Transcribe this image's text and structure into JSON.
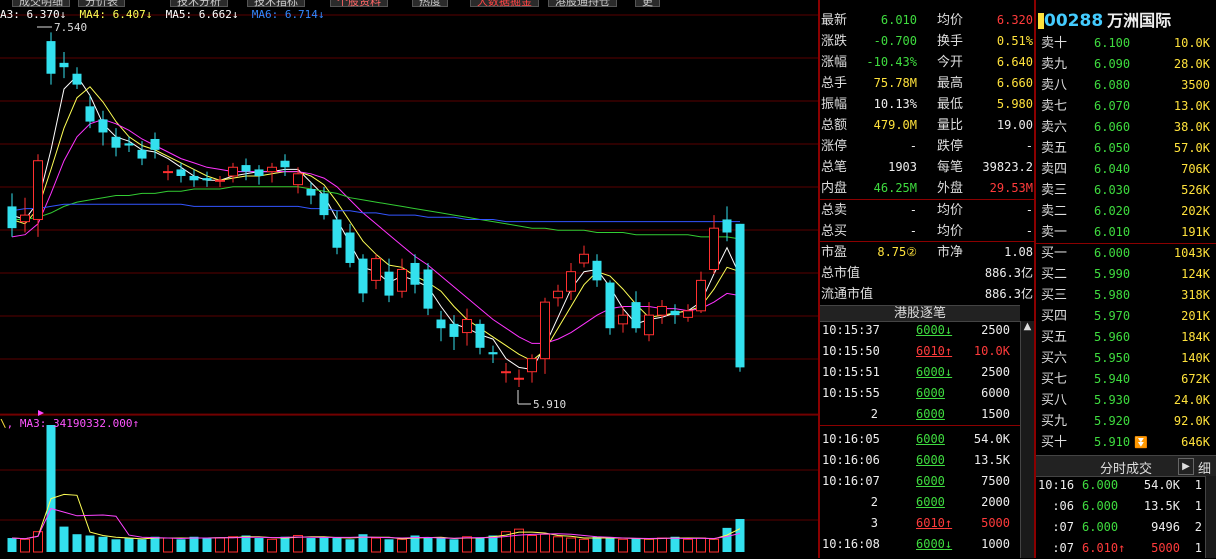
{
  "tabs": [
    "成交明细",
    "分价表",
    "技术分析",
    "技术指标",
    "个股资料",
    "热度",
    "大数据掘金",
    "港股通持仓",
    "更多"
  ],
  "stock": {
    "code_prefix": "",
    "code": "00288",
    "name": "万洲国际"
  },
  "ma_legend": {
    "ma3": "A3: 6.370↓",
    "ma4": "MA4: 6.407↓",
    "ma5": "MA5: 6.662↓",
    "ma6": "MA6: 6.714↓"
  },
  "vol_legend": {
    "text": "MA3: 34190332.000↑"
  },
  "chart_annotations": {
    "high": "7.540",
    "low": "5.910"
  },
  "quote": [
    {
      "l1": "最新",
      "v1": "6.010",
      "c1": "green",
      "l2": "均价",
      "v2": "6.320",
      "c2": "red"
    },
    {
      "l1": "涨跌",
      "v1": "-0.700",
      "c1": "green",
      "l2": "换手",
      "v2": "0.51%",
      "c2": "yellow"
    },
    {
      "l1": "涨幅",
      "v1": "-10.43%",
      "c1": "green",
      "l2": "今开",
      "v2": "6.640",
      "c2": "yellow"
    },
    {
      "l1": "总手",
      "v1": "75.78M",
      "c1": "yellow",
      "l2": "最高",
      "v2": "6.660",
      "c2": "yellow"
    },
    {
      "l1": "振幅",
      "v1": "10.13%",
      "c1": "white",
      "l2": "最低",
      "v2": "5.980",
      "c2": "yellow"
    },
    {
      "l1": "总额",
      "v1": "479.0M",
      "c1": "yellow",
      "l2": "量比",
      "v2": "19.00",
      "c2": "white"
    },
    {
      "l1": "涨停",
      "v1": "-",
      "c1": "white",
      "l2": "跌停",
      "v2": "-",
      "c2": "white"
    },
    {
      "l1": "总笔",
      "v1": "1903",
      "c1": "white",
      "l2": "每笔",
      "v2": "39823.2",
      "c2": "white"
    },
    {
      "l1": "内盘",
      "v1": "46.25M",
      "c1": "green",
      "l2": "外盘",
      "v2": "29.53M",
      "c2": "red"
    },
    {
      "l1": "总卖",
      "v1": "-",
      "c1": "white",
      "l2": "均价",
      "v2": "-",
      "c2": "white"
    },
    {
      "l1": "总买",
      "v1": "-",
      "c1": "white",
      "l2": "均价",
      "v2": "-",
      "c2": "white"
    },
    {
      "l1": "市盈",
      "v1": "8.75②",
      "c1": "yellow",
      "l2": "市净",
      "v2": "1.08",
      "c2": "white"
    },
    {
      "l1": "总市值",
      "v1": "",
      "c1": "white",
      "l2": "",
      "v2": "886.3亿",
      "c2": "white"
    },
    {
      "l1": "流通市值",
      "v1": "",
      "c1": "white",
      "l2": "",
      "v2": "886.3亿",
      "c2": "white"
    }
  ],
  "asks": [
    {
      "label": "卖十",
      "price": "6.100",
      "vol": "10.0K"
    },
    {
      "label": "卖九",
      "price": "6.090",
      "vol": "28.0K"
    },
    {
      "label": "卖八",
      "price": "6.080",
      "vol": "3500"
    },
    {
      "label": "卖七",
      "price": "6.070",
      "vol": "13.0K"
    },
    {
      "label": "卖六",
      "price": "6.060",
      "vol": "38.0K"
    },
    {
      "label": "卖五",
      "price": "6.050",
      "vol": "57.0K"
    },
    {
      "label": "卖四",
      "price": "6.040",
      "vol": "706K"
    },
    {
      "label": "卖三",
      "price": "6.030",
      "vol": "526K"
    },
    {
      "label": "卖二",
      "price": "6.020",
      "vol": "202K"
    },
    {
      "label": "卖一",
      "price": "6.010",
      "vol": "191K"
    }
  ],
  "bids": [
    {
      "label": "买一",
      "price": "6.000",
      "vol": "1043K"
    },
    {
      "label": "买二",
      "price": "5.990",
      "vol": "124K"
    },
    {
      "label": "买三",
      "price": "5.980",
      "vol": "318K"
    },
    {
      "label": "买四",
      "price": "5.970",
      "vol": "201K"
    },
    {
      "label": "买五",
      "price": "5.960",
      "vol": "184K"
    },
    {
      "label": "买六",
      "price": "5.950",
      "vol": "140K"
    },
    {
      "label": "买七",
      "price": "5.940",
      "vol": "672K"
    },
    {
      "label": "买八",
      "price": "5.930",
      "vol": "24.0K"
    },
    {
      "label": "买九",
      "price": "5.920",
      "vol": "92.0K"
    },
    {
      "label": "买十",
      "price": "5.910",
      "vol": "646K"
    }
  ],
  "hk_ticks_title": "港股逐笔",
  "hk_ticks": [
    {
      "time": "10:15:37",
      "price": "6000",
      "arrow": "↓",
      "pc": "green",
      "vol": "2500",
      "vc": "white"
    },
    {
      "time": "10:15:50",
      "price": "6010",
      "arrow": "↑",
      "pc": "red",
      "vol": "10.0K",
      "vc": "red"
    },
    {
      "time": "10:15:51",
      "price": "6000",
      "arrow": "↓",
      "pc": "green",
      "vol": "2500",
      "vc": "white"
    },
    {
      "time": "10:15:55",
      "price": "6000",
      "arrow": "",
      "pc": "green",
      "vol": "6000",
      "vc": "white"
    },
    {
      "time": "2",
      "price": "6000",
      "arrow": "",
      "pc": "green",
      "vol": "1500",
      "vc": "white"
    },
    {
      "time": "10:16:05",
      "price": "6000",
      "arrow": "",
      "pc": "green",
      "vol": "54.0K",
      "vc": "white"
    },
    {
      "time": "10:16:06",
      "price": "6000",
      "arrow": "",
      "pc": "green",
      "vol": "13.5K",
      "vc": "white"
    },
    {
      "time": "10:16:07",
      "price": "6000",
      "arrow": "",
      "pc": "green",
      "vol": "7500",
      "vc": "white"
    },
    {
      "time": "2",
      "price": "6000",
      "arrow": "",
      "pc": "green",
      "vol": "2000",
      "vc": "white"
    },
    {
      "time": "3",
      "price": "6010",
      "arrow": "↑",
      "pc": "red",
      "vol": "5000",
      "vc": "red"
    },
    {
      "time": "10:16:08",
      "price": "6000",
      "arrow": "↓",
      "pc": "green",
      "vol": "1000",
      "vc": "white"
    }
  ],
  "min_ticks_title": "分时成交",
  "min_ticks_side": "细",
  "min_ticks": [
    {
      "time": "10:16",
      "price": "6.000",
      "arrow": "",
      "pc": "green",
      "vol": "54.0K",
      "vc": "white",
      "n": "1"
    },
    {
      "time": ":06",
      "price": "6.000",
      "arrow": "",
      "pc": "green",
      "vol": "13.5K",
      "vc": "white",
      "n": "1"
    },
    {
      "time": ":07",
      "price": "6.000",
      "arrow": "",
      "pc": "green",
      "vol": "9496",
      "vc": "white",
      "n": "2"
    },
    {
      "time": ":07",
      "price": "6.010",
      "arrow": "↑",
      "pc": "red",
      "vol": "5000",
      "vc": "red",
      "n": "1"
    }
  ],
  "chart_data": {
    "type": "candlestick",
    "candles": [
      [
        6.74,
        6.64,
        6.8,
        6.6
      ],
      [
        6.67,
        6.7,
        6.78,
        6.62
      ],
      [
        6.68,
        6.95,
        6.98,
        6.6
      ],
      [
        7.5,
        7.35,
        7.54,
        7.3
      ],
      [
        7.4,
        7.38,
        7.45,
        7.33
      ],
      [
        7.35,
        7.3,
        7.38,
        7.28
      ],
      [
        7.2,
        7.13,
        7.25,
        7.1
      ],
      [
        7.14,
        7.08,
        7.18,
        7.02
      ],
      [
        7.06,
        7.01,
        7.1,
        6.97
      ],
      [
        7.03,
        7.02,
        7.06,
        6.99
      ],
      [
        7.0,
        6.96,
        7.04,
        6.93
      ],
      [
        7.05,
        7.0,
        7.08,
        6.96
      ],
      [
        6.9,
        6.9,
        6.93,
        6.86
      ],
      [
        6.91,
        6.88,
        6.94,
        6.85
      ],
      [
        6.88,
        6.86,
        6.91,
        6.83
      ],
      [
        6.87,
        6.86,
        6.9,
        6.83
      ],
      [
        6.86,
        6.86,
        6.88,
        6.83
      ],
      [
        6.88,
        6.92,
        6.94,
        6.85
      ],
      [
        6.93,
        6.9,
        6.96,
        6.86
      ],
      [
        6.91,
        6.88,
        6.93,
        6.84
      ],
      [
        6.9,
        6.92,
        6.94,
        6.85
      ],
      [
        6.95,
        6.92,
        6.98,
        6.88
      ],
      [
        6.84,
        6.89,
        6.92,
        6.8
      ],
      [
        6.82,
        6.79,
        6.85,
        6.75
      ],
      [
        6.8,
        6.7,
        6.83,
        6.68
      ],
      [
        6.68,
        6.55,
        6.72,
        6.52
      ],
      [
        6.62,
        6.48,
        6.66,
        6.46
      ],
      [
        6.5,
        6.34,
        6.52,
        6.3
      ],
      [
        6.4,
        6.5,
        6.52,
        6.36
      ],
      [
        6.44,
        6.33,
        6.5,
        6.3
      ],
      [
        6.35,
        6.45,
        6.5,
        6.32
      ],
      [
        6.48,
        6.38,
        6.52,
        6.34
      ],
      [
        6.45,
        6.27,
        6.48,
        6.24
      ],
      [
        6.22,
        6.18,
        6.26,
        6.12
      ],
      [
        6.2,
        6.14,
        6.24,
        6.08
      ],
      [
        6.16,
        6.22,
        6.27,
        6.1
      ],
      [
        6.2,
        6.09,
        6.22,
        6.06
      ],
      [
        6.07,
        6.06,
        6.1,
        6.02
      ],
      [
        5.98,
        5.98,
        6.02,
        5.93
      ],
      [
        5.95,
        5.95,
        5.99,
        5.91
      ],
      [
        5.98,
        6.04,
        6.06,
        5.93
      ],
      [
        6.04,
        6.3,
        6.32,
        5.97
      ],
      [
        6.32,
        6.35,
        6.38,
        6.28
      ],
      [
        6.35,
        6.44,
        6.48,
        6.31
      ],
      [
        6.48,
        6.52,
        6.56,
        6.46
      ],
      [
        6.49,
        6.4,
        6.52,
        6.37
      ],
      [
        6.39,
        6.18,
        6.4,
        6.15
      ],
      [
        6.2,
        6.24,
        6.28,
        6.16
      ],
      [
        6.3,
        6.18,
        6.35,
        6.16
      ],
      [
        6.15,
        6.24,
        6.3,
        6.12
      ],
      [
        6.24,
        6.28,
        6.31,
        6.2
      ],
      [
        6.26,
        6.24,
        6.29,
        6.2
      ],
      [
        6.23,
        6.26,
        6.29,
        6.21
      ],
      [
        6.26,
        6.4,
        6.44,
        6.25
      ],
      [
        6.45,
        6.64,
        6.7,
        6.43
      ],
      [
        6.68,
        6.62,
        6.74,
        6.58
      ],
      [
        6.66,
        6.0,
        6.66,
        5.98
      ]
    ],
    "ma_lines": {
      "ma3": [
        6.7,
        6.68,
        6.76,
        7.0,
        7.28,
        7.34,
        7.25,
        7.12,
        7.06,
        7.04,
        7.0,
        6.99,
        6.96,
        6.92,
        6.88,
        6.86,
        6.86,
        6.88,
        6.89,
        6.9,
        6.9,
        6.91,
        6.91,
        6.85,
        6.79,
        6.68,
        6.57,
        6.46,
        6.44,
        6.39,
        6.42,
        6.4,
        6.37,
        6.28,
        6.2,
        6.18,
        6.15,
        6.13,
        6.04,
        6.0,
        5.99,
        6.1,
        6.23,
        6.36,
        6.44,
        6.45,
        6.37,
        6.27,
        6.2,
        6.22,
        6.23,
        6.25,
        6.26,
        6.3,
        6.43,
        6.55,
        6.42
      ],
      "ma4": [
        6.68,
        6.66,
        6.73,
        6.91,
        7.1,
        7.24,
        7.29,
        7.22,
        7.13,
        7.06,
        7.02,
        7.0,
        6.97,
        6.94,
        6.91,
        6.88,
        6.86,
        6.87,
        6.88,
        6.88,
        6.89,
        6.9,
        6.9,
        6.88,
        6.84,
        6.76,
        6.67,
        6.58,
        6.52,
        6.47,
        6.46,
        6.42,
        6.39,
        6.35,
        6.28,
        6.22,
        6.18,
        6.14,
        6.1,
        6.06,
        6.03,
        6.08,
        6.18,
        6.28,
        6.38,
        6.44,
        6.42,
        6.36,
        6.29,
        6.23,
        6.24,
        6.25,
        6.26,
        6.28,
        6.36,
        6.46,
        6.44
      ],
      "ma5": [
        6.6,
        6.61,
        6.66,
        6.8,
        6.95,
        7.06,
        7.12,
        7.14,
        7.12,
        7.09,
        7.05,
        7.02,
        6.99,
        6.96,
        6.94,
        6.92,
        6.91,
        6.9,
        6.9,
        6.9,
        6.9,
        6.9,
        6.9,
        6.89,
        6.87,
        6.83,
        6.77,
        6.71,
        6.66,
        6.61,
        6.56,
        6.51,
        6.47,
        6.42,
        6.37,
        6.32,
        6.27,
        6.22,
        6.18,
        6.14,
        6.11,
        6.11,
        6.13,
        6.16,
        6.2,
        6.24,
        6.27,
        6.28,
        6.28,
        6.28,
        6.27,
        6.27,
        6.26,
        6.27,
        6.3,
        6.34,
        6.33
      ],
      "ma6": [
        6.68,
        6.68,
        6.69,
        6.71,
        6.74,
        6.76,
        6.77,
        6.78,
        6.79,
        6.79,
        6.8,
        6.8,
        6.81,
        6.81,
        6.82,
        6.82,
        6.82,
        6.83,
        6.83,
        6.83,
        6.83,
        6.83,
        6.83,
        6.82,
        6.81,
        6.8,
        6.78,
        6.77,
        6.76,
        6.75,
        6.74,
        6.73,
        6.72,
        6.71,
        6.7,
        6.69,
        6.68,
        6.67,
        6.66,
        6.65,
        6.64,
        6.64,
        6.63,
        6.63,
        6.63,
        6.62,
        6.62,
        6.62,
        6.61,
        6.61,
        6.61,
        6.61,
        6.61,
        6.6,
        6.6,
        6.6,
        6.59
      ],
      "ma7": [
        6.72,
        6.73,
        6.73,
        6.74,
        6.75,
        6.75,
        6.75,
        6.75,
        6.75,
        6.75,
        6.75,
        6.75,
        6.75,
        6.75,
        6.74,
        6.74,
        6.74,
        6.74,
        6.74,
        6.74,
        6.74,
        6.74,
        6.74,
        6.73,
        6.73,
        6.72,
        6.72,
        6.71,
        6.71,
        6.7,
        6.7,
        6.7,
        6.69,
        6.69,
        6.69,
        6.68,
        6.68,
        6.68,
        6.67,
        6.67,
        6.67,
        6.67,
        6.67,
        6.67,
        6.67,
        6.67,
        6.67,
        6.67,
        6.67,
        6.67,
        6.67,
        6.67,
        6.67,
        6.67,
        6.67,
        6.67,
        6.67
      ]
    },
    "ma_colors": {
      "ma3": "#ffffff",
      "ma4": "#ffff55",
      "ma5": "#ff33ff",
      "ma6": "#33cc33",
      "ma7": "#3355ff"
    },
    "volume": [
      1.1,
      1.0,
      1.6,
      10.0,
      2.0,
      1.4,
      1.3,
      1.2,
      1.0,
      1.1,
      1.0,
      1.2,
      1.1,
      1.0,
      1.2,
      1.1,
      1.1,
      1.2,
      1.3,
      1.1,
      1.0,
      1.2,
      1.3,
      1.1,
      1.2,
      1.1,
      1.0,
      1.4,
      1.1,
      1.0,
      1.0,
      1.3,
      1.1,
      1.1,
      1.0,
      1.2,
      1.1,
      1.3,
      1.6,
      1.8,
      1.3,
      1.4,
      1.2,
      1.1,
      1.0,
      1.2,
      1.1,
      1.0,
      1.1,
      1.0,
      1.1,
      1.2,
      1.0,
      1.1,
      1.0,
      1.9,
      2.6
    ],
    "price_range": [
      5.85,
      7.62
    ],
    "colors": {
      "up": "#ff3030",
      "down": "#33e0ee"
    }
  }
}
